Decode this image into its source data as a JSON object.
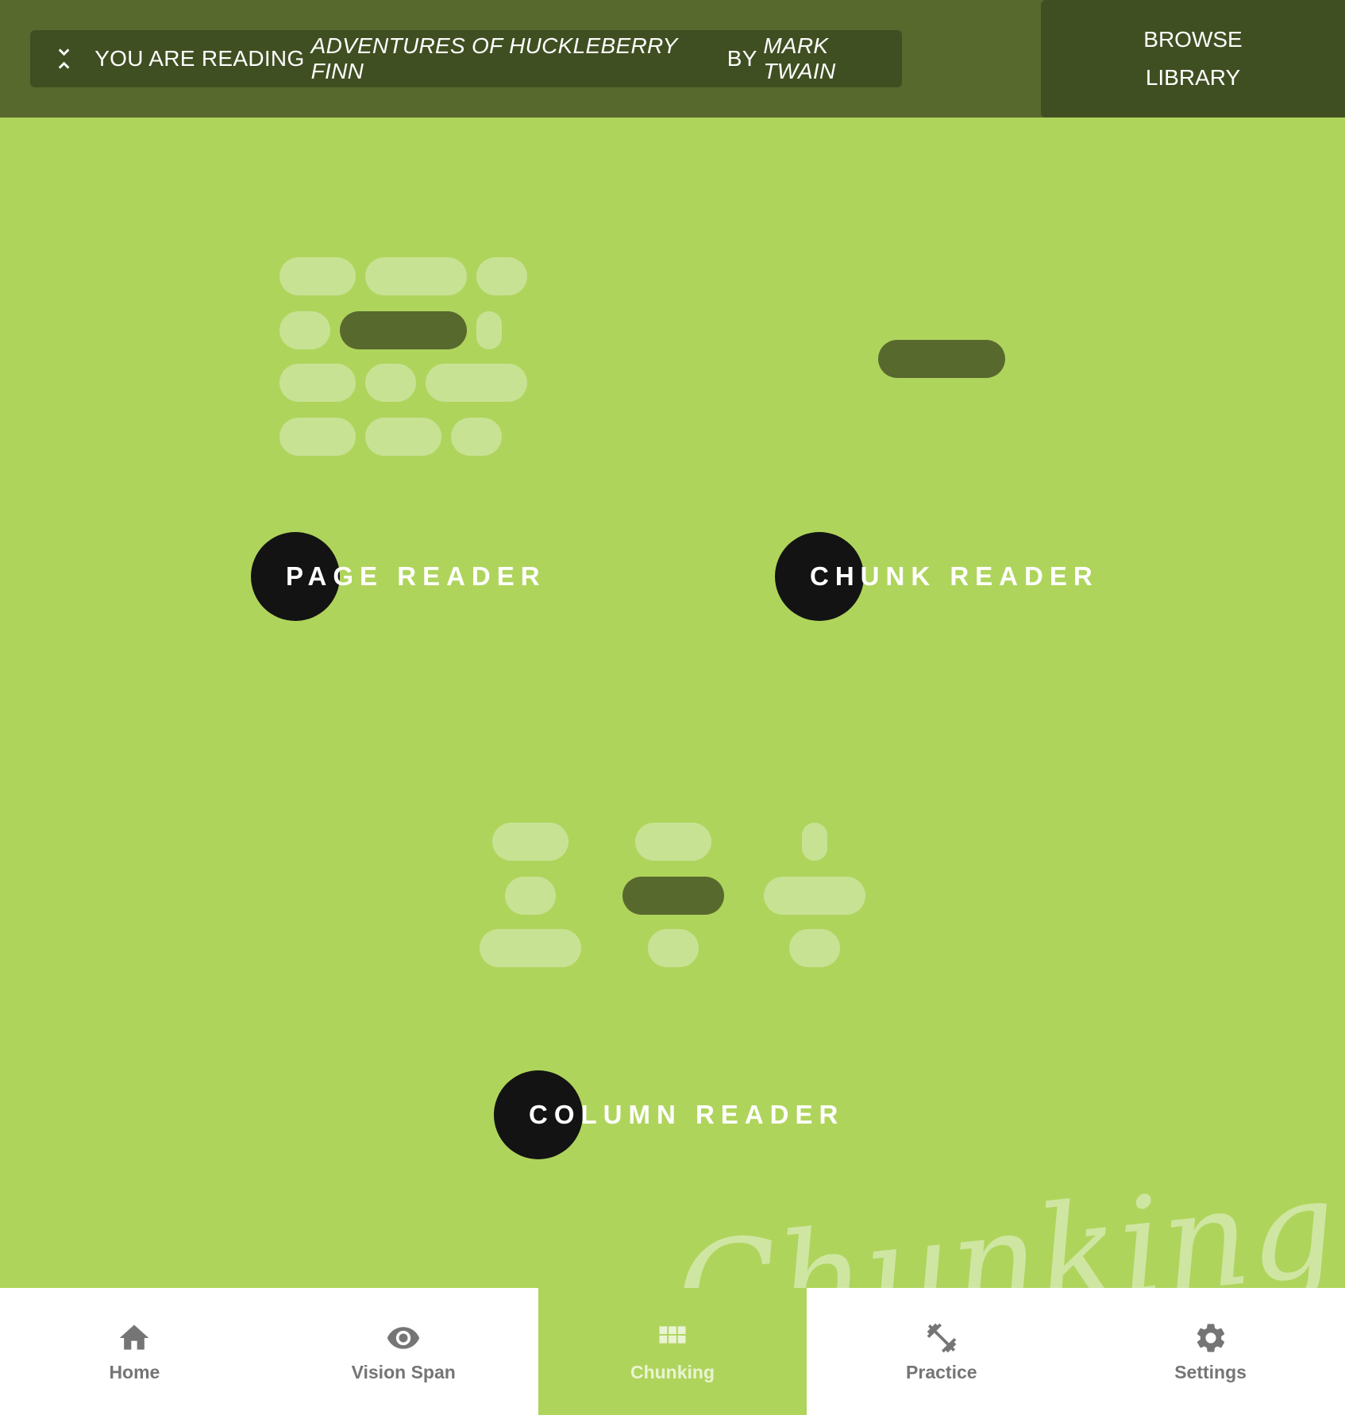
{
  "header": {
    "reading_prefix": "YOU ARE READING ",
    "book_title": "ADVENTURES OF HUCKLEBERRY FINN",
    "by_text": " BY ",
    "author": "MARK TWAIN",
    "browse_line1": "BROWSE",
    "browse_line2": "LIBRARY"
  },
  "modes": {
    "page_reader": "PAGE READER",
    "chunk_reader": "CHUNK READER",
    "column_reader": "COLUMN READER"
  },
  "watermark": "Chunking",
  "nav": {
    "items": [
      {
        "label": "Home",
        "icon": "home-icon"
      },
      {
        "label": "Vision Span",
        "icon": "eye-icon"
      },
      {
        "label": "Chunking",
        "icon": "grid-icon"
      },
      {
        "label": "Practice",
        "icon": "dumbbell-icon"
      },
      {
        "label": "Settings",
        "icon": "gear-icon"
      }
    ],
    "active": "Chunking"
  },
  "colors": {
    "header_bg": "#58692e",
    "banner_bg": "#404f22",
    "main_bg": "#afd45c",
    "pill_light": "#c8e294",
    "pill_active": "#58692e",
    "circle": "#131313",
    "nav_inactive": "#757575"
  }
}
